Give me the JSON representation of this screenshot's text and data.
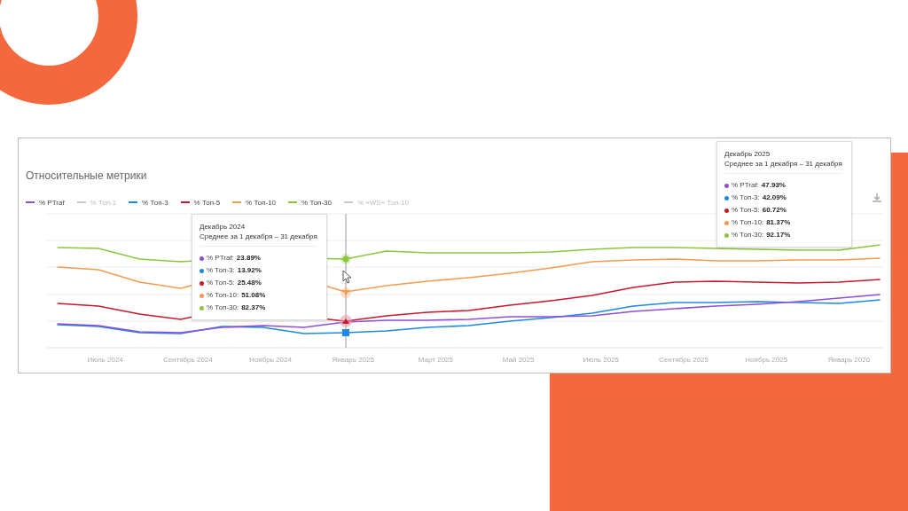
{
  "card": {
    "title": "Относительные метрики",
    "legend": [
      {
        "label": "% PTraf",
        "color": "#8e4fd6",
        "on": true
      },
      {
        "label": "% Топ-1",
        "color": "#c8c8c8",
        "on": false
      },
      {
        "label": "% Топ-3",
        "color": "#1e88e5",
        "on": true
      },
      {
        "label": "% Топ-5",
        "color": "#c8182c",
        "on": true
      },
      {
        "label": "% Топ-10",
        "color": "#f79a4e",
        "on": true
      },
      {
        "label": "% Топ-30",
        "color": "#8cc63f",
        "on": true
      },
      {
        "label": "% «WS» Топ-10",
        "color": "#c8c8c8",
        "on": false
      }
    ],
    "x_axis_labels": [
      "Июль 2024",
      "Сентябрь 2024",
      "Ноябрь 2024",
      "Январь 2025",
      "Март 2025",
      "Май 2025",
      "Июль 2025",
      "Сентябрь 2025",
      "Ноябрь 2025",
      "Январь 2026"
    ],
    "tooltips": [
      {
        "title": "Декабрь 2024",
        "subtitle": "Среднее за 1 декабря – 31 декабря",
        "rows": [
          {
            "label": "% PTraf:",
            "value": "23.89%",
            "color": "#8e4fd6"
          },
          {
            "label": "% Топ-3:",
            "value": "13.92%",
            "color": "#1e88e5"
          },
          {
            "label": "% Топ-5:",
            "value": "25.48%",
            "color": "#c8182c"
          },
          {
            "label": "% Топ-10:",
            "value": "51.08%",
            "color": "#f79a4e"
          },
          {
            "label": "% Топ-30:",
            "value": "82.37%",
            "color": "#8cc63f"
          }
        ]
      },
      {
        "title": "Декабрь 2025",
        "subtitle": "Среднее за 1 декабря – 31 декабря",
        "rows": [
          {
            "label": "% PTraf:",
            "value": "47.93%",
            "color": "#8e4fd6"
          },
          {
            "label": "% Топ-3:",
            "value": "42.09%",
            "color": "#1e88e5"
          },
          {
            "label": "% Топ-5:",
            "value": "60.72%",
            "color": "#c8182c"
          },
          {
            "label": "% Топ-10:",
            "value": "81.37%",
            "color": "#f79a4e"
          },
          {
            "label": "% Топ-30:",
            "value": "92.17%",
            "color": "#8cc63f"
          }
        ]
      }
    ]
  }
}
